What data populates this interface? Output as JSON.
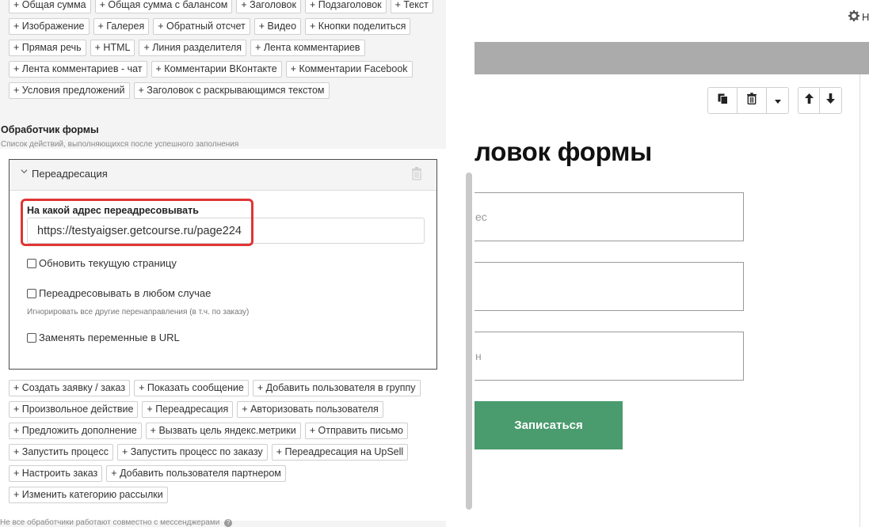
{
  "top_buttons": [
    [
      "+ Общая сумма",
      "+ Общая сумма с балансом",
      "+ Заголовок",
      "+ Подзаголовок",
      "+ Текст"
    ],
    [
      "+ Изображение",
      "+ Галерея",
      "+ Обратный отсчет",
      "+ Видео",
      "+ Кнопки поделиться"
    ],
    [
      "+ Прямая речь",
      "+ HTML",
      "+ Линия разделителя",
      "+ Лента комментариев"
    ],
    [
      "+ Лента комментариев - чат",
      "+ Комментарии ВКонтакте",
      "+ Комментарии Facebook"
    ],
    [
      "+ Условия предложений",
      "+ Заголовок с раскрывающимся текстом"
    ]
  ],
  "handler": {
    "title": "Обработчик формы",
    "subtitle": "Список действий, выполняющихся после успешного заполнения"
  },
  "redirect_card": {
    "title": "Переадресация",
    "url_label": "На какой адрес переадресовывать",
    "url_value": "https://testyaigser.getcourse.ru/page224",
    "refresh_label": "Обновить текущую страницу",
    "always_label": "Переадресовывать в любом случае",
    "ignore_note": "Игнорировать все другие перенаправления (в т.ч. по заказу)",
    "replace_label": "Заменять переменные в URL"
  },
  "bottom_buttons": [
    [
      "+ Создать заявку / заказ",
      "+ Показать сообщение",
      "+ Добавить пользователя в группу"
    ],
    [
      "+ Произвольное действие",
      "+ Переадресация",
      "+ Авторизовать пользователя"
    ],
    [
      "+ Предложить дополнение",
      "+ Вызвать цель яндекс.метрики",
      "+ Отправить письмо"
    ],
    [
      "+ Запустить процесс",
      "+ Запустить процесс по заказу",
      "+ Переадресация на UpSell"
    ],
    [
      "+ Настроить заказ",
      "+ Добавить пользователя партнером"
    ],
    [
      "+ Изменить категорию рассылки"
    ]
  ],
  "bottom_hint": "Не все обработчики работают совместно с мессенджерами",
  "preview": {
    "gear_label": "Н",
    "heading": "ловок формы",
    "input1_placeholder": "ес",
    "input3_placeholder": "н",
    "submit_label": "Записаться"
  },
  "colors": {
    "accent_green": "#4a9b6e",
    "highlight_red": "#e03535",
    "gray_band": "#ababab"
  }
}
